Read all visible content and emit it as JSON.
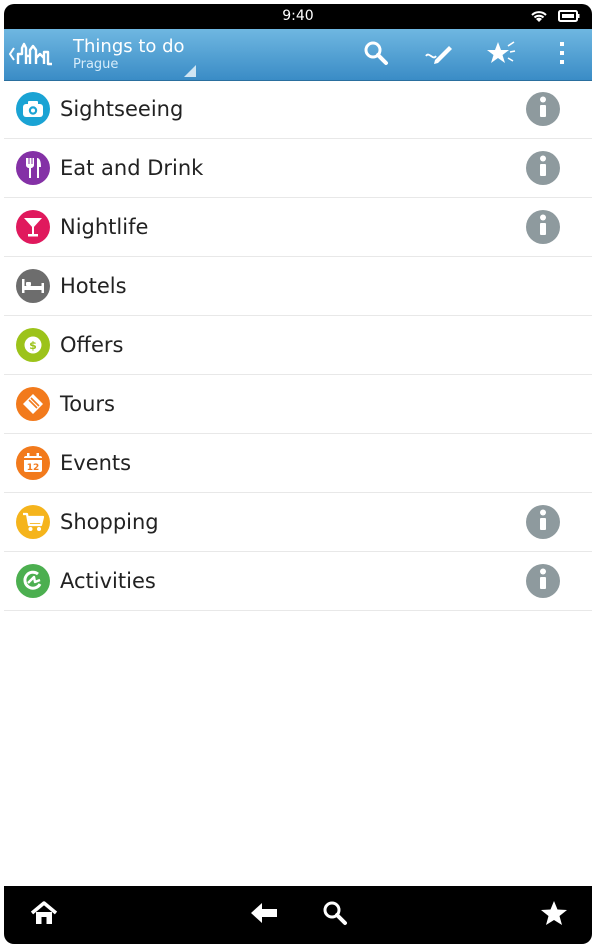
{
  "status_bar": {
    "time": "9:40",
    "icons": [
      "wifi-icon",
      "battery-icon"
    ]
  },
  "action_bar": {
    "app_icon": "city-skyline-icon",
    "title": "Things to do",
    "subtitle": "Prague",
    "actions": [
      "search-icon",
      "pencil-icon",
      "star-icon",
      "overflow-menu-icon"
    ]
  },
  "categories": [
    {
      "label": "Sightseeing",
      "color": "#1aa3d4",
      "icon": "camera-icon",
      "info": true
    },
    {
      "label": "Eat and Drink",
      "color": "#8431a6",
      "icon": "cutlery-icon",
      "info": true
    },
    {
      "label": "Nightlife",
      "color": "#e0195d",
      "icon": "cocktail-icon",
      "info": true
    },
    {
      "label": "Hotels",
      "color": "#6d6d6d",
      "icon": "bed-icon",
      "info": false
    },
    {
      "label": "Offers",
      "color": "#9cc31a",
      "icon": "dollar-coin-icon",
      "info": false
    },
    {
      "label": "Tours",
      "color": "#f27a1c",
      "icon": "ticket-icon",
      "info": false
    },
    {
      "label": "Events",
      "color": "#f27a1c",
      "icon": "calendar-icon",
      "calendar_day": "12",
      "info": false
    },
    {
      "label": "Shopping",
      "color": "#f5b41c",
      "icon": "shopping-cart-icon",
      "info": true
    },
    {
      "label": "Activities",
      "color": "#4caf50",
      "icon": "activity-icon",
      "info": true
    }
  ],
  "nav_bar": [
    "home-icon",
    "back-icon",
    "search-icon",
    "favorites-star-icon"
  ]
}
